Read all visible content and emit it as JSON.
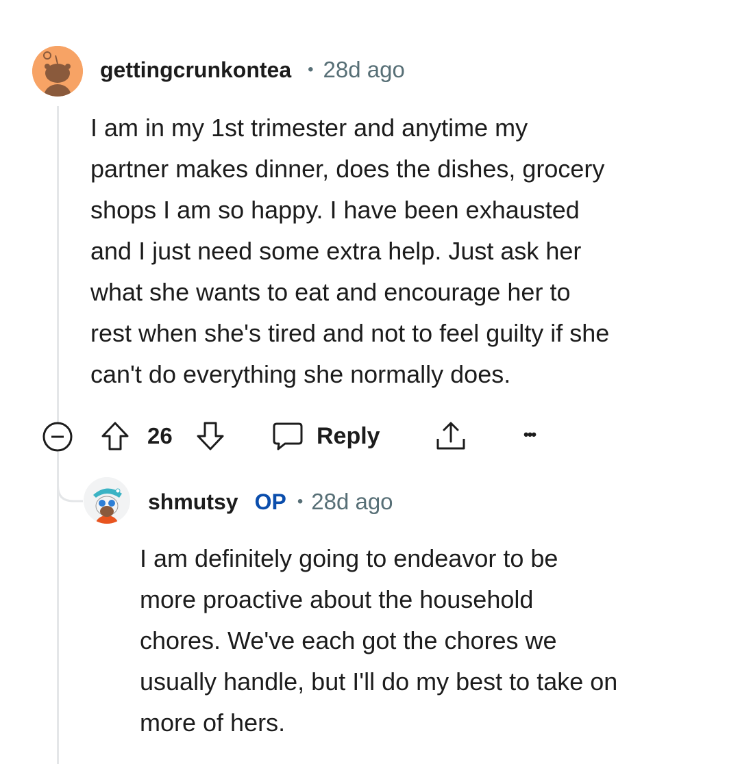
{
  "comment": {
    "username": "gettingcrunkontea",
    "separator": "•",
    "time": "28d ago",
    "body_lines": [
      "I am in my 1st trimester and anytime my",
      "partner makes dinner, does the dishes, grocery",
      "shops I am so happy. I have been exhausted",
      "and I just need some extra help. Just ask her",
      "what she wants to eat and encourage her to",
      "rest when she's tired and not to feel guilty if she",
      "can't do everything she normally does."
    ],
    "actions": {
      "vote_count": "26",
      "reply_label": "Reply",
      "more_label": "•••"
    }
  },
  "reply": {
    "username": "shmutsy",
    "op_badge": "OP",
    "separator": "•",
    "time": "28d ago",
    "body_lines": [
      "I am definitely going to endeavor to be",
      "more proactive about the household",
      "chores. We've each got the chores we",
      "usually handle, but I'll do my best to take on",
      "more of hers."
    ]
  },
  "colors": {
    "avatar_bg": "#f7a365",
    "text": "#1c1c1c",
    "meta": "#576f76",
    "op": "#0a4dac",
    "thread_line": "#e4e6e8"
  }
}
